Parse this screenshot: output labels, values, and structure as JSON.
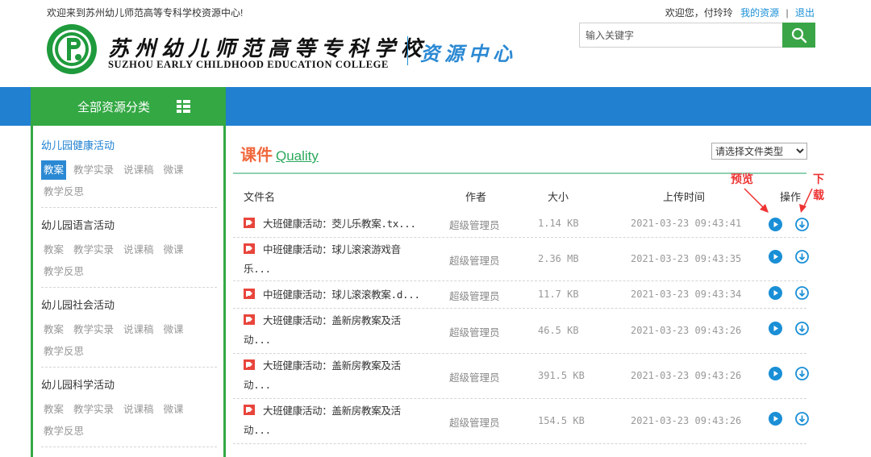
{
  "header": {
    "welcome": "欢迎来到苏州幼儿师范高等专科学校资源中心!",
    "user_greeting": "欢迎您，付玲玲",
    "my_resources": "我的资源",
    "separator": "|",
    "logout": "退出",
    "logo_cn": "苏州幼儿师范高等专科学校",
    "logo_en": "SUZHOU EARLY CHILDHOOD EDUCATION COLLEGE",
    "logo_resource": "资源中心",
    "search_placeholder": "输入关键字"
  },
  "nav": {
    "all_categories": "全部资源分类"
  },
  "sidebar": {
    "groups": [
      {
        "title": "幼儿园健康活动",
        "tags": [
          "教案",
          "教学实录",
          "说课稿",
          "微课",
          "教学反思"
        ],
        "active_tag": "教案"
      },
      {
        "title": "幼儿园语言活动",
        "tags": [
          "教案",
          "教学实录",
          "说课稿",
          "微课",
          "教学反思"
        ]
      },
      {
        "title": "幼儿园社会活动",
        "tags": [
          "教案",
          "教学实录",
          "说课稿",
          "微课",
          "教学反思"
        ]
      },
      {
        "title": "幼儿园科学活动",
        "tags": [
          "教案",
          "教学实录",
          "说课稿",
          "微课",
          "教学反思"
        ]
      }
    ]
  },
  "main": {
    "title_cn": "课件",
    "title_en": "Quality",
    "type_select": "请选择文件类型",
    "annotation_preview": "预览",
    "annotation_download": "下载",
    "columns": {
      "file": "文件名",
      "author": "作者",
      "size": "大小",
      "time": "上传时间",
      "ops": "操作"
    },
    "rows": [
      {
        "name": "大班健康活动：茭儿乐教案.tx...",
        "author": "超级管理员",
        "size": "1.14 KB",
        "time": "2021-03-23 09:43:41"
      },
      {
        "name": "中班健康活动：球儿滚滚游戏音乐...",
        "author": "超级管理员",
        "size": "2.36 MB",
        "time": "2021-03-23 09:43:35"
      },
      {
        "name": "中班健康活动：球儿滚滚教案.d...",
        "author": "超级管理员",
        "size": "11.7 KB",
        "time": "2021-03-23 09:43:34"
      },
      {
        "name": "大班健康活动：盖新房教案及活动...",
        "author": "超级管理员",
        "size": "46.5 KB",
        "time": "2021-03-23 09:43:26"
      },
      {
        "name": "大班健康活动：盖新房教案及活动...",
        "author": "超级管理员",
        "size": "391.5 KB",
        "time": "2021-03-23 09:43:26"
      },
      {
        "name": "大班健康活动：盖新房教案及活动...",
        "author": "超级管理员",
        "size": "154.5 KB",
        "time": "2021-03-23 09:43:26"
      }
    ]
  },
  "colors": {
    "nav_blue": "#2180d0",
    "green": "#33a843",
    "title_orange": "#f0683c",
    "annotation_red": "#ee3333"
  },
  "icons": [
    "emblem-logo",
    "search-icon",
    "grid-menu-icon",
    "file-type-icon",
    "preview-play-icon",
    "download-icon"
  ]
}
